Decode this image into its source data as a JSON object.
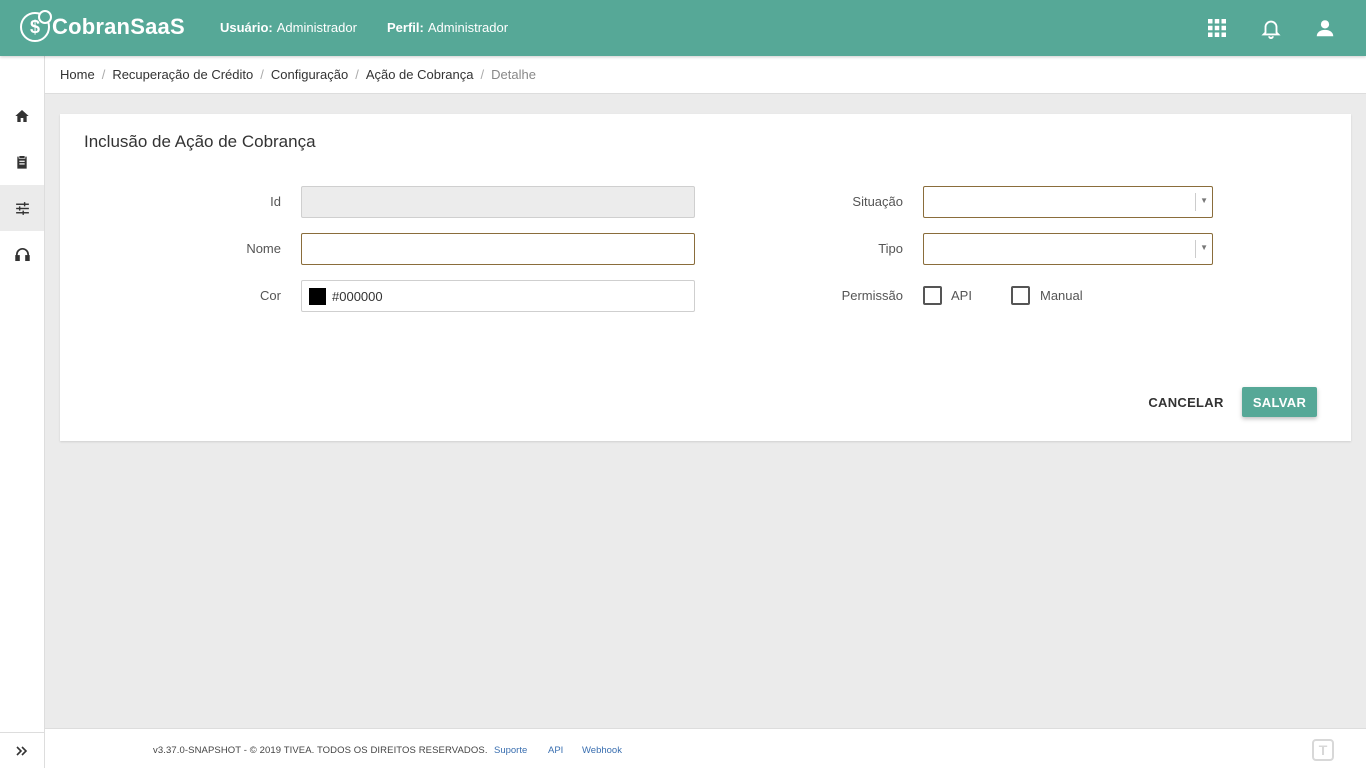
{
  "header": {
    "brand": "CobranSaaS",
    "user_label": "Usuário:",
    "user_value": "Administrador",
    "profile_label": "Perfil:",
    "profile_value": "Administrador",
    "icons": [
      "apps-grid-icon",
      "notifications-bell-icon",
      "account-icon"
    ],
    "accent_color": "#56a897"
  },
  "sidebar": {
    "items": [
      {
        "icon": "home-icon"
      },
      {
        "icon": "clipboard-icon"
      },
      {
        "icon": "tune-sliders-icon",
        "active": true
      },
      {
        "icon": "headset-icon"
      }
    ],
    "expand_icon": "double-chevron-right-icon"
  },
  "breadcrumb": {
    "items": [
      "Home",
      "Recuperação de Crédito",
      "Configuração",
      "Ação de Cobrança"
    ],
    "current": "Detalhe",
    "separator": "/"
  },
  "form": {
    "title": "Inclusão de Ação de Cobrança",
    "id": {
      "label": "Id",
      "value": ""
    },
    "nome": {
      "label": "Nome",
      "value": ""
    },
    "cor": {
      "label": "Cor",
      "value": "#000000",
      "swatch": "#000000"
    },
    "situacao": {
      "label": "Situação",
      "value": ""
    },
    "tipo": {
      "label": "Tipo",
      "value": ""
    },
    "permissao": {
      "label": "Permissão",
      "options": [
        {
          "label": "API",
          "checked": false
        },
        {
          "label": "Manual",
          "checked": false
        }
      ]
    },
    "cancel_label": "CANCELAR",
    "save_label": "SALVAR"
  },
  "footer": {
    "copyright": "v3.37.0-SNAPSHOT - © 2019 TIVEA. TODOS OS DIREITOS RESERVADOS.",
    "links": [
      "Suporte",
      "API",
      "Webhook"
    ],
    "brand_glyph": "T"
  }
}
